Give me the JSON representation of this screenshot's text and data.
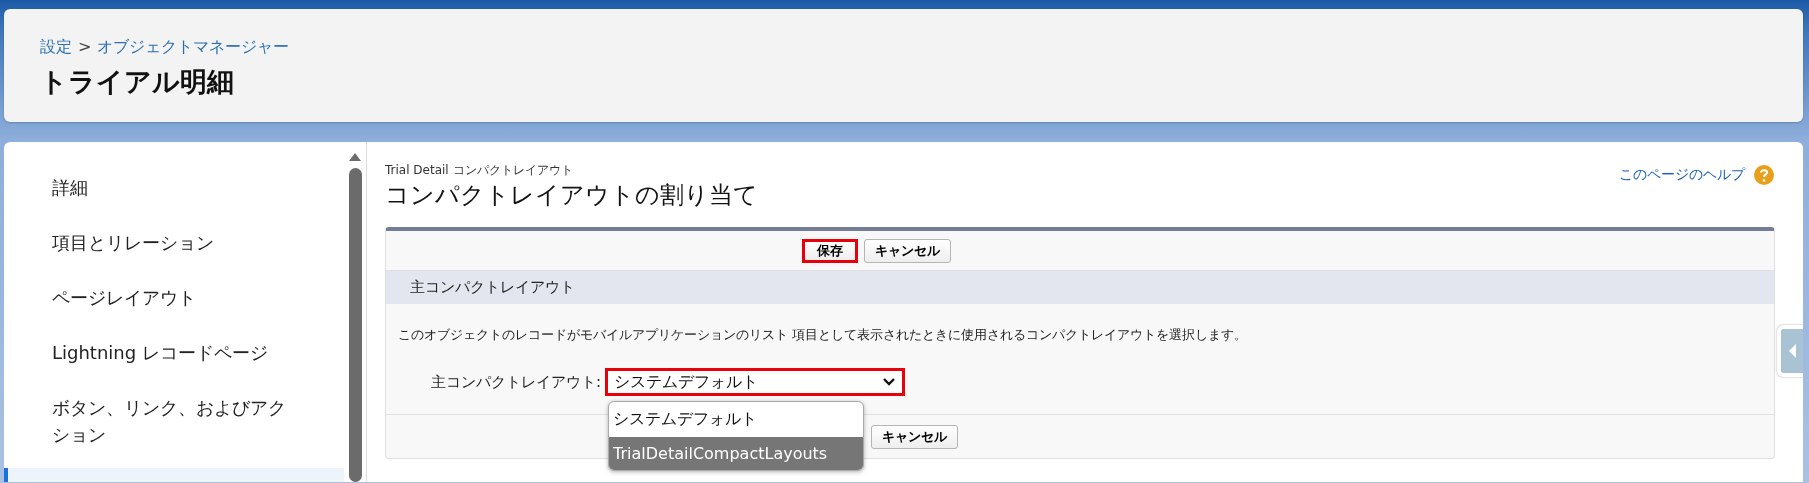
{
  "header": {
    "breadcrumb": [
      {
        "label": "設定"
      },
      {
        "label": "オブジェクトマネージャー"
      }
    ],
    "breadcrumb_separator": ">",
    "title": "トライアル明細"
  },
  "sidebar": {
    "items": [
      {
        "label": "詳細",
        "selected": false
      },
      {
        "label": "項目とリレーション",
        "selected": false
      },
      {
        "label": "ページレイアウト",
        "selected": false
      },
      {
        "label": "Lightning レコードページ",
        "selected": false
      },
      {
        "label": "ボタン、リンク、およびアクション",
        "selected": false
      },
      {
        "selected": true
      }
    ]
  },
  "main": {
    "subtitle": "Trial Detail コンパクトレイアウト",
    "title": "コンパクトレイアウトの割り当て",
    "help_link": "このページのヘルプ",
    "top_buttons": [
      {
        "label": "保存",
        "highlighted": true
      },
      {
        "label": "キャンセル",
        "highlighted": false
      }
    ],
    "section_title": "主コンパクトレイアウト",
    "description": "このオブジェクトのレコードがモバイルアプリケーションのリスト 項目として表示されたときに使用されるコンパクトレイアウトを選択します。",
    "field": {
      "label": "主コンパクトレイアウト:",
      "value": "システムデフォルト",
      "highlighted": true,
      "options": [
        {
          "label": "システムデフォルト",
          "hovered": false
        },
        {
          "label": "TrialDetailCompactLayouts",
          "hovered": true
        }
      ]
    },
    "bottom_buttons": [
      {
        "label": "キャンセル",
        "highlighted": false
      }
    ]
  }
}
